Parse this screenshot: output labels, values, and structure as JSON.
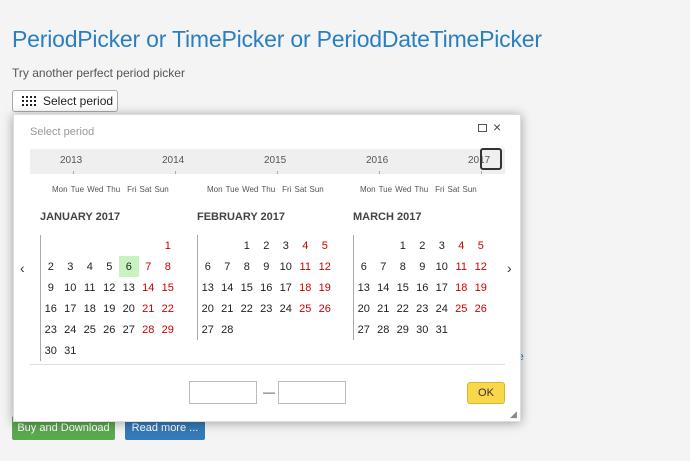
{
  "page": {
    "title": "PeriodPicker or TimePicker or PeriodDateTimePicker",
    "subtitle": "Try another perfect period picker",
    "select_button_label": "Select period",
    "buy_label": "Buy and Download",
    "read_label": "Read more ...",
    "bg_link_fragment": "re"
  },
  "picker": {
    "title": "Select period",
    "years": [
      "2013",
      "2014",
      "2015",
      "2016",
      "2017"
    ],
    "weekdays": [
      "Mon",
      "Tue",
      "Wed",
      "Thu",
      "Fri",
      "Sat",
      "Sun"
    ],
    "ok_label": "OK",
    "from_value": "",
    "to_value": "",
    "months": [
      {
        "title": "JANUARY 2017",
        "offset": 6,
        "days": 31,
        "today": 6
      },
      {
        "title": "FEBRUARY 2017",
        "offset": 2,
        "days": 28
      },
      {
        "title": "MARCH 2017",
        "offset": 2,
        "days": 31
      }
    ],
    "colors": {
      "accent": "#2a7fc1",
      "weekend": "#cc0000",
      "today_bg": "#c8f3c0",
      "ok_bg": "#f9d64a",
      "buy_bg": "#5ba84f",
      "read_bg": "#3579b8"
    }
  }
}
